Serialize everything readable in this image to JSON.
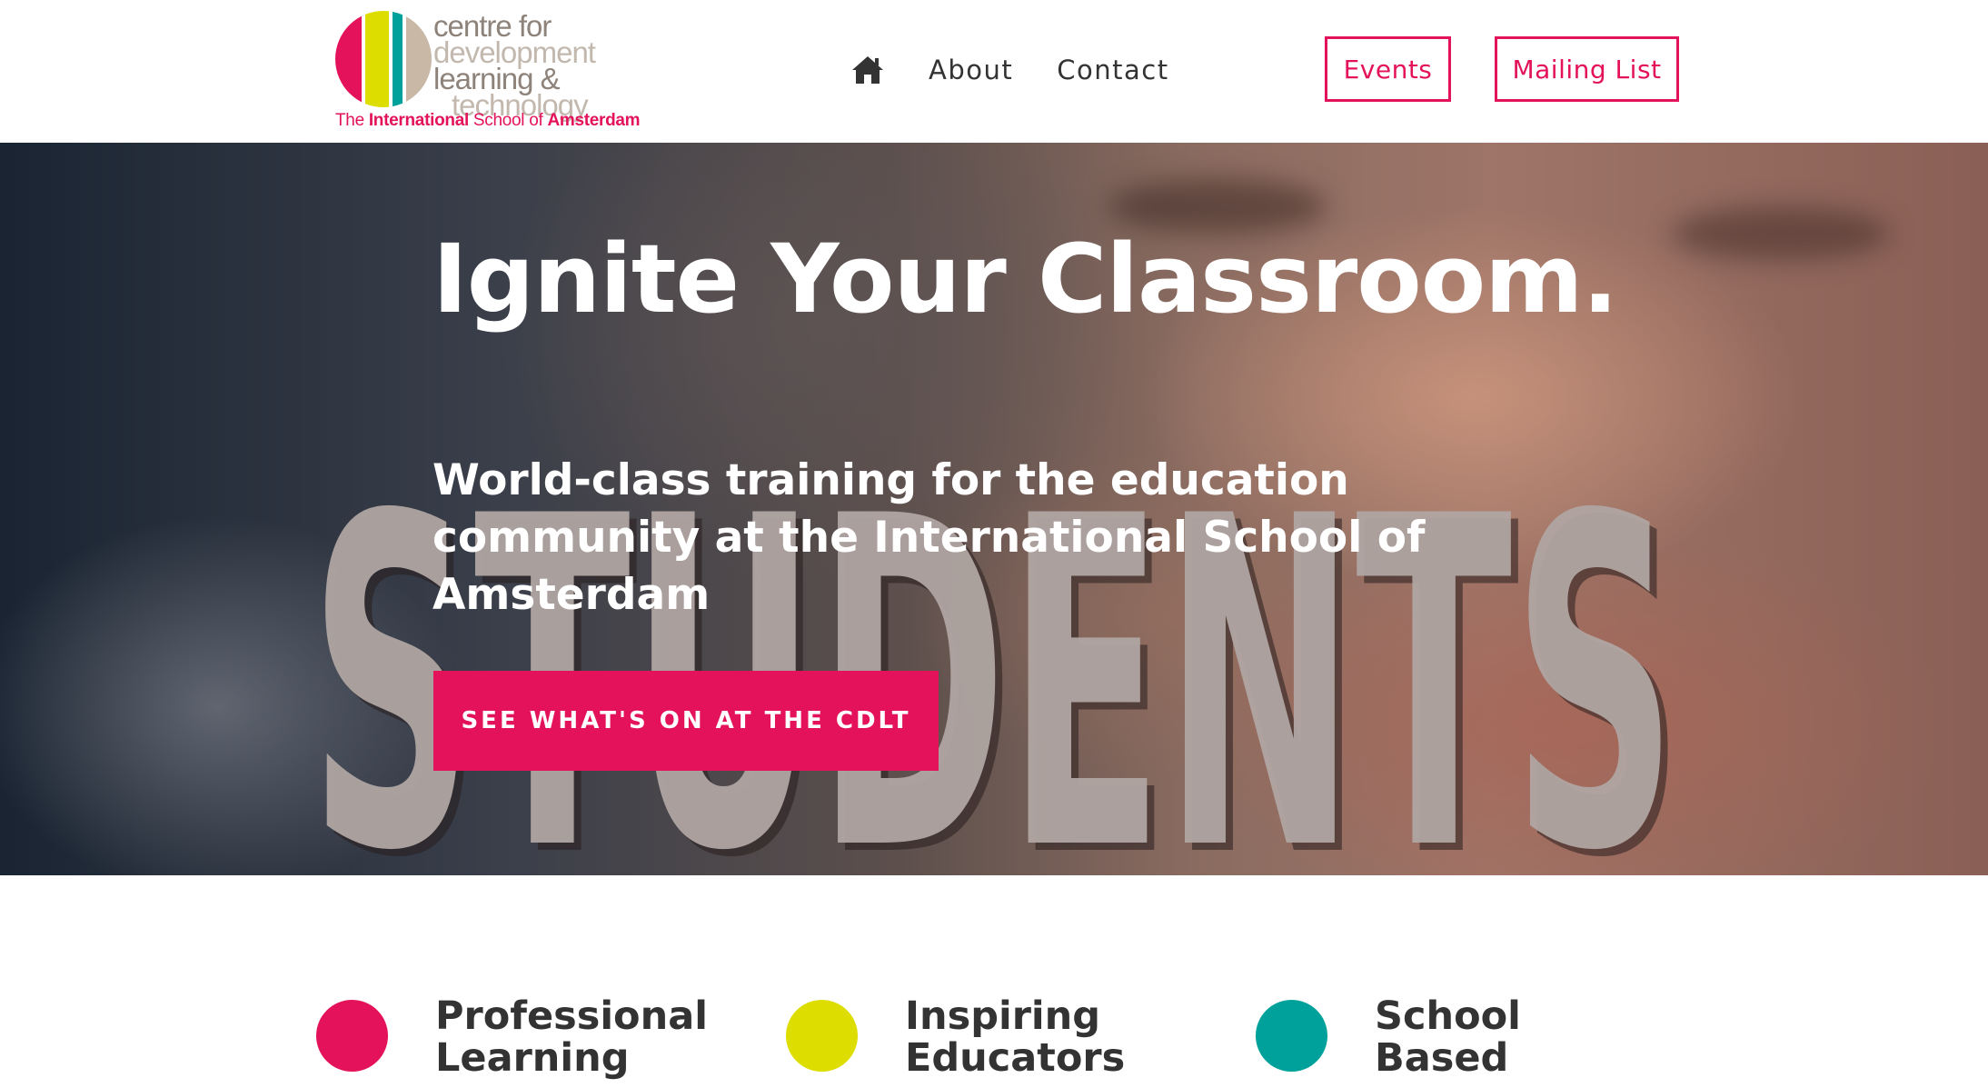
{
  "header": {
    "logo": {
      "lines": [
        "centre for",
        "development",
        "learning &",
        "technology"
      ],
      "sub_prefix": "The ",
      "sub_bold1": "International",
      "sub_mid": " School of ",
      "sub_bold2": "Amsterdam",
      "stripe_colors": [
        "#e3125a",
        "#dedd00",
        "#00a19a",
        "#c9b8a6"
      ]
    },
    "nav": {
      "home_icon": "home-icon",
      "about": "About",
      "contact": "Contact"
    },
    "buttons": {
      "events": "Events",
      "mailing_list": "Mailing List"
    },
    "accent_color": "#e3125a"
  },
  "hero": {
    "title": "Ignite Your Classroom.",
    "background_word": "STUDENTS",
    "subtitle": "World-class training for the education community at the International School of Amsterdam",
    "cta": "SEE WHAT'S ON AT THE CDLT"
  },
  "features": [
    {
      "title": "Professional\nLearning",
      "color": "#e3125a"
    },
    {
      "title": "Inspiring\nEducators",
      "color": "#dedd00"
    },
    {
      "title": "School\nBased",
      "color": "#00a19a"
    }
  ]
}
